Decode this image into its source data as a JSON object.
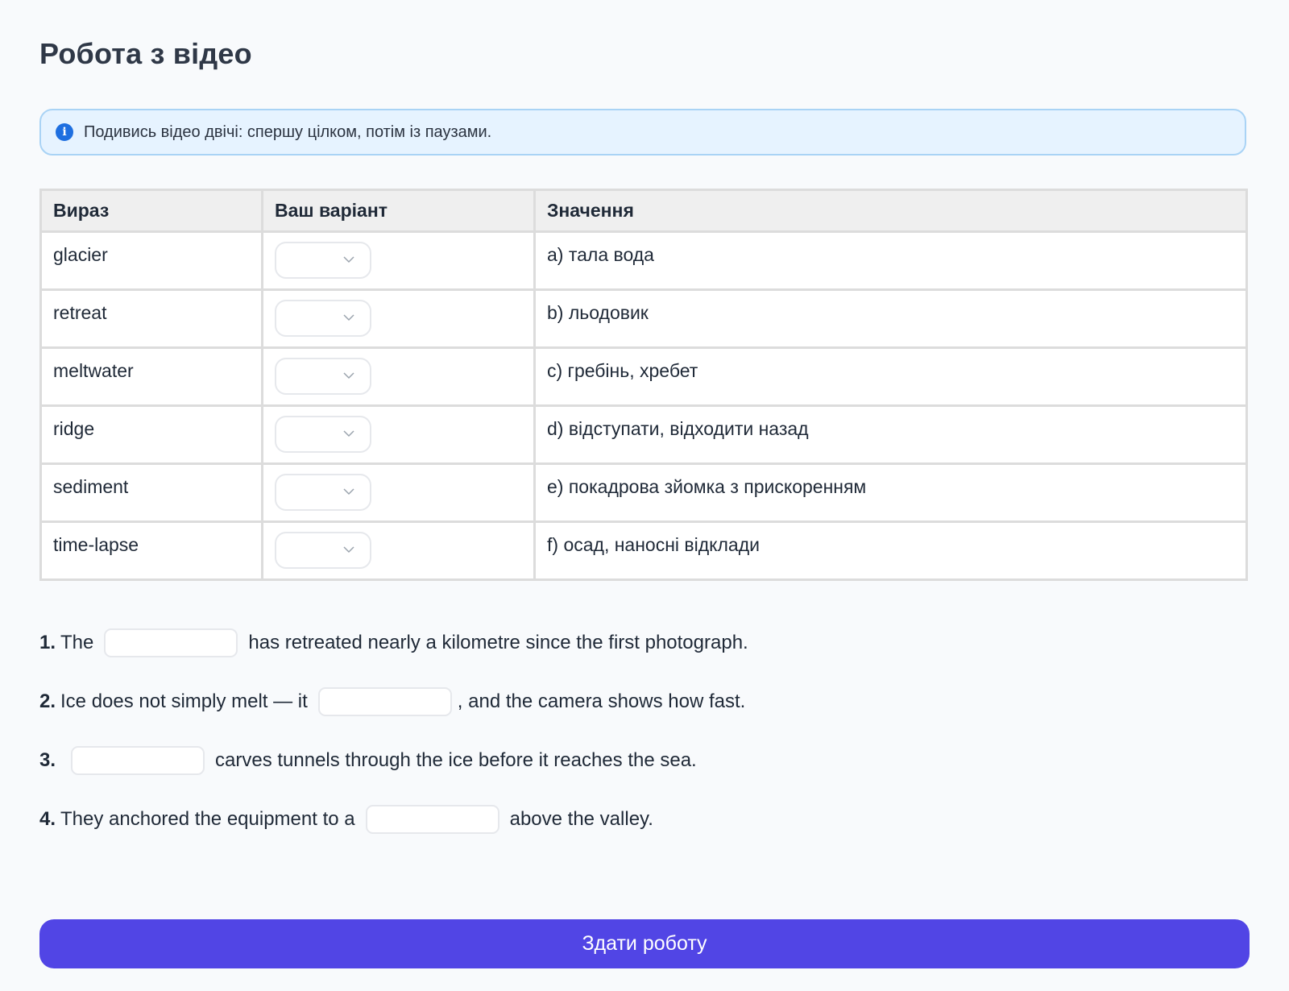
{
  "page": {
    "title": "Робота з відео"
  },
  "info": {
    "icon": "info-icon",
    "icon_glyph": "i",
    "text": "Подивись відео двічі: спершу цілком, потім із паузами."
  },
  "table": {
    "headers": [
      "Вираз",
      "Ваш варіант",
      "Значення"
    ],
    "rows": [
      {
        "term": "glacier",
        "answer": "",
        "meaning": "a) тала вода"
      },
      {
        "term": "retreat",
        "answer": "",
        "meaning": "b) льодовик"
      },
      {
        "term": "meltwater",
        "answer": "",
        "meaning": "c) гребінь, хребет"
      },
      {
        "term": "ridge",
        "answer": "",
        "meaning": "d) відступати, відходити назад"
      },
      {
        "term": "sediment",
        "answer": "",
        "meaning": "e) покадрова зйомка з прискоренням"
      },
      {
        "term": "time-lapse",
        "answer": "",
        "meaning": "f) осад, наносні відклади"
      }
    ]
  },
  "exercises": [
    {
      "number": "1.",
      "before": "The",
      "after": "has retreated nearly a kilometre since the first photograph.",
      "value": ""
    },
    {
      "number": "2.",
      "before": "Ice does not simply melt — it",
      "after": ", and the camera shows how fast.",
      "value": ""
    },
    {
      "number": "3.",
      "before": "",
      "after": "carves tunnels through the ice before it reaches the sea.",
      "value": ""
    },
    {
      "number": "4.",
      "before": "They anchored the equipment to a",
      "after": "above the valley.",
      "value": ""
    }
  ],
  "submit": {
    "label": "Здати роботу"
  },
  "colors": {
    "accent": "#5145e5",
    "info_bg": "#e6f3ff",
    "info_border": "#a9d3f5",
    "info_icon": "#1e6fe0"
  }
}
